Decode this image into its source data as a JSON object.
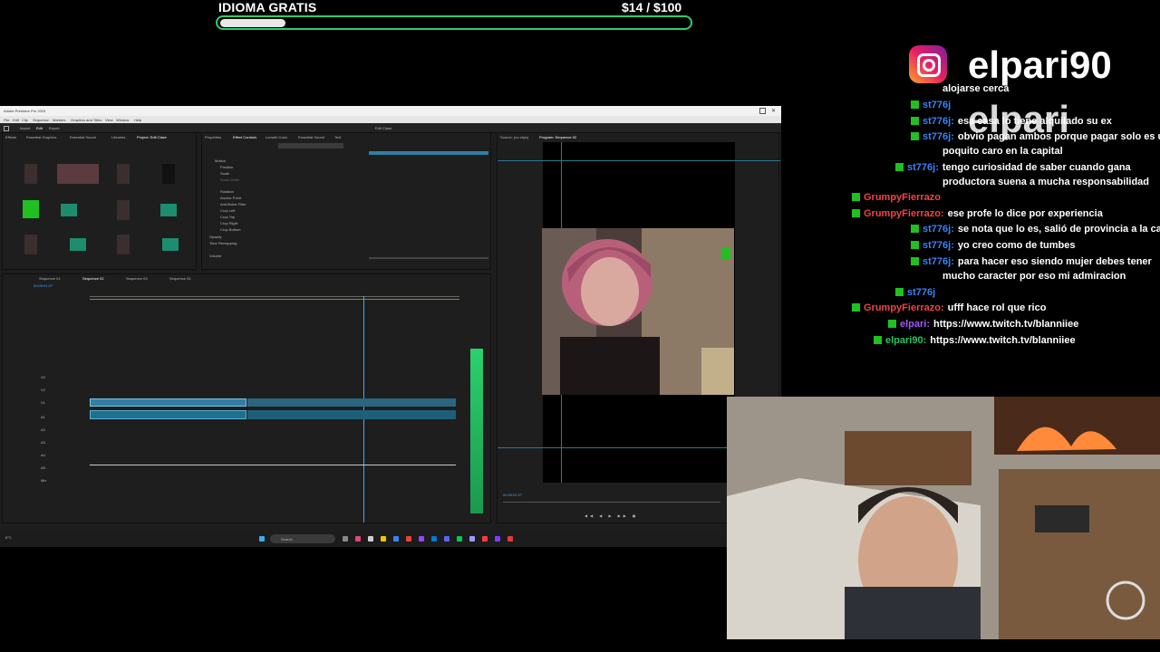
{
  "goal": {
    "title": "IDIOMA GRATIS",
    "amount": "$14  / $100",
    "progress": 0.14,
    "color": "#2ecc71"
  },
  "social": {
    "icon": "instagram-icon",
    "handle": "elpari90",
    "ghost_text": "elpari"
  },
  "chat": {
    "messages": [
      {
        "user": "",
        "text": "alojarse cerca",
        "color": "#ffffff"
      },
      {
        "user": "st776j",
        "text": "",
        "color": "#3b82f6"
      },
      {
        "user": "st776j",
        "text": "esa casa lo tiene alquilado su ex",
        "color": "#3b82f6"
      },
      {
        "user": "st776j",
        "text": "obvio pagan ambos porque pagar solo es un",
        "color": "#3b82f6"
      },
      {
        "user": "",
        "text": "poquito caro en la capital",
        "color": "#3b82f6"
      },
      {
        "user": "st776j",
        "text": "tengo curiosidad de saber cuando gana",
        "color": "#3b82f6"
      },
      {
        "user": "",
        "text": "productora suena a mucha responsabilidad",
        "color": "#3b82f6"
      },
      {
        "user": "GrumpyFierrazo",
        "text": "",
        "color": "#ef4444"
      },
      {
        "user": "GrumpyFierrazo",
        "text": "ese profe lo dice por experiencia",
        "color": "#ef4444"
      },
      {
        "user": "st776j",
        "text": "se nota que lo es, salió de provincia a la capital",
        "color": "#3b82f6"
      },
      {
        "user": "st776j",
        "text": "yo creo como de tumbes",
        "color": "#3b82f6"
      },
      {
        "user": "st776j",
        "text": "para hacer eso siendo mujer debes tener",
        "color": "#3b82f6"
      },
      {
        "user": "",
        "text": "mucho caracter por eso mi admiracion",
        "color": "#3b82f6"
      },
      {
        "user": "st776j",
        "text": "",
        "color": "#3b82f6"
      },
      {
        "user": "GrumpyFierrazo",
        "text": "ufff hace rol que rico",
        "color": "#ef4444"
      },
      {
        "user": "elpari",
        "text": "https://www.twitch.tv/blanniiee",
        "color": "#a855f7"
      },
      {
        "user": "elpari90",
        "text": "https://www.twitch.tv/blanniiee",
        "color": "#22c55e"
      }
    ]
  },
  "premiere": {
    "title": "Adobe Premiere Pro 2023",
    "menu": [
      "File",
      "Edit",
      "Clip",
      "Sequence",
      "Markers",
      "Graphics and Titles",
      "View",
      "Window",
      "Help"
    ],
    "workspace_tabs": [
      "Import",
      "Edit",
      "Export"
    ],
    "panels": {
      "project": [
        "Effects",
        "Essential Graphics",
        "Essential Sound",
        "Libraries",
        "Project: Edit Clase"
      ],
      "effect_controls": [
        "Properties",
        "Effect Controls",
        "Lumetri Color",
        "Essential Sound",
        "Text"
      ],
      "program": "Program: Sequence 02",
      "source": "Source: (no clips)"
    },
    "sequence_tabs": [
      "Sequence 01",
      "Sequence 02",
      "Sequence 03",
      "Sequence 04"
    ],
    "timecode_timeline": "00:00:01:27",
    "timecode_program": "00:00:01:27",
    "tracks": [
      "V3",
      "V2",
      "V1",
      "A1",
      "A2",
      "A3",
      "A4",
      "A5",
      "Mix"
    ],
    "effect_properties": [
      "Motion",
      "Position",
      "Scale",
      "Scale Width",
      "Rotation",
      "Anchor Point",
      "Anti-flicker Filter",
      "Crop Left",
      "Crop Top",
      "Crop Right",
      "Crop Bottom",
      "Opacity",
      "Time Remapping",
      "Volume"
    ],
    "taskbar_search": "Search",
    "weather": "8°C"
  }
}
